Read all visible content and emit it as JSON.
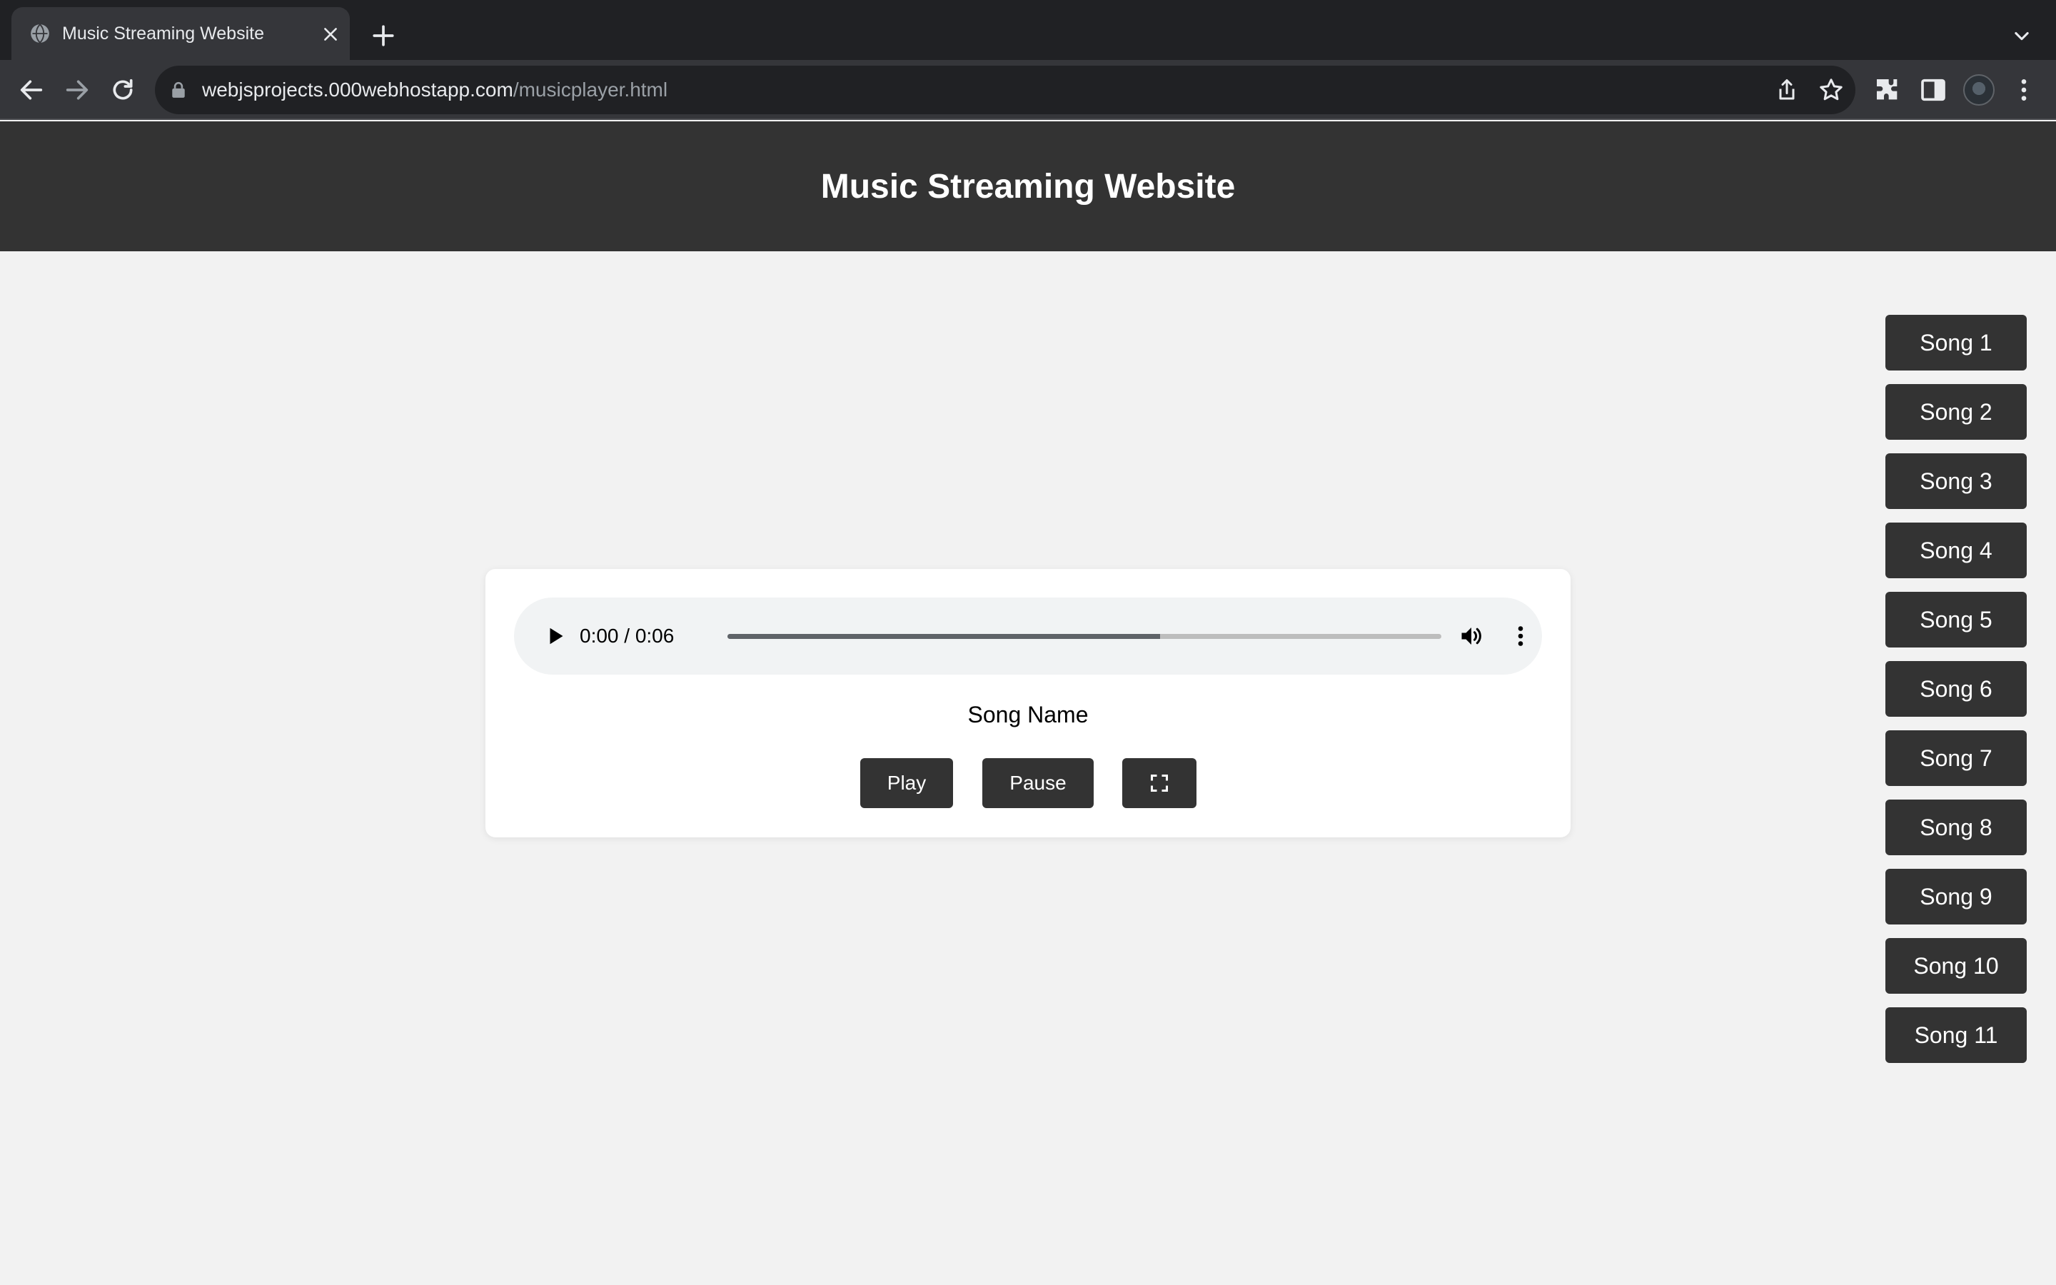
{
  "browser": {
    "tab_title": "Music Streaming Website",
    "url_host": "webjsprojects.000webhostapp.com",
    "url_path": "/musicplayer.html"
  },
  "page": {
    "title": "Music Streaming Website"
  },
  "player": {
    "time_display": "0:00 / 0:06",
    "buffered_fraction": 0.606,
    "song_name": "Song Name",
    "play_label": "Play",
    "pause_label": "Pause",
    "fullscreen_icon": "fullscreen-icon"
  },
  "songs": [
    "Song 1",
    "Song 2",
    "Song 3",
    "Song 4",
    "Song 5",
    "Song 6",
    "Song 7",
    "Song 8",
    "Song 9",
    "Song 10",
    "Song 11"
  ],
  "colors": {
    "header_bg": "#333333",
    "page_bg": "#f2f2f2",
    "button_bg": "#333333",
    "button_text": "#ffffff"
  }
}
